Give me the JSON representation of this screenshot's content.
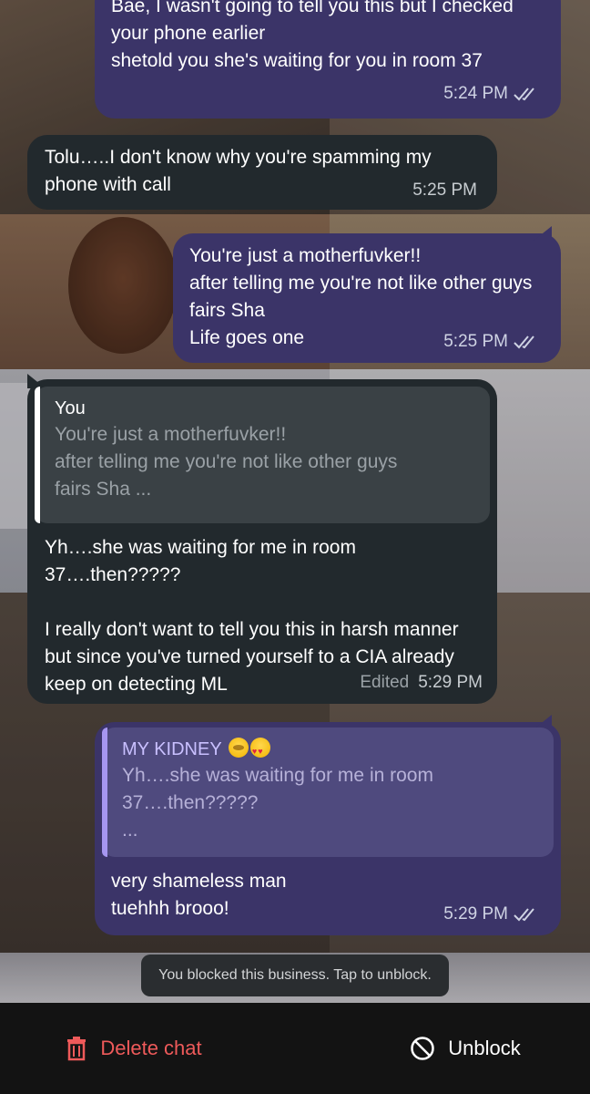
{
  "messages": [
    {
      "direction": "outgoing",
      "text": "Bae, I wasn't going to tell you this but I checked\nyour phone earlier\nshetold you she's waiting for you in room 37",
      "time": "5:24 PM"
    },
    {
      "direction": "incoming",
      "text": "Tolu…..I don't know why you're spamming my\nphone with call",
      "time": "5:25 PM"
    },
    {
      "direction": "outgoing",
      "text": "You're just a motherfuvker!!\nafter telling me you're not like other guys\nfairs Sha\nLife goes one",
      "time": "5:25 PM"
    },
    {
      "direction": "incoming",
      "reply": {
        "author": "You",
        "text": "You're just a motherfuvker!!\nafter telling me you're not like other guys\nfairs Sha ..."
      },
      "text": "Yh….she was waiting for me in room\n37….then?????\n\nI really don't want to tell you this in harsh manner\nbut since you've turned yourself to a CIA already\nkeep on detecting ML",
      "edited_label": "Edited",
      "time": "5:29 PM"
    },
    {
      "direction": "outgoing",
      "reply": {
        "author": "MY KIDNEY",
        "text": "Yh….she was waiting for me in room\n37….then?????\n..."
      },
      "text": "very shameless man\ntuehhh brooo!",
      "time": "5:29 PM"
    }
  ],
  "toast": "You blocked this business. Tap to unblock.",
  "bottom_bar": {
    "delete_label": "Delete chat",
    "unblock_label": "Unblock"
  },
  "colors": {
    "outgoing_bubble": "#3b3468",
    "incoming_bubble": "#22292d",
    "delete_red": "#ee5a5a"
  },
  "icons": [
    "double-check-icon",
    "trash-icon",
    "block-icon",
    "pleading-face-emoji",
    "heart-eyes-emoji"
  ]
}
